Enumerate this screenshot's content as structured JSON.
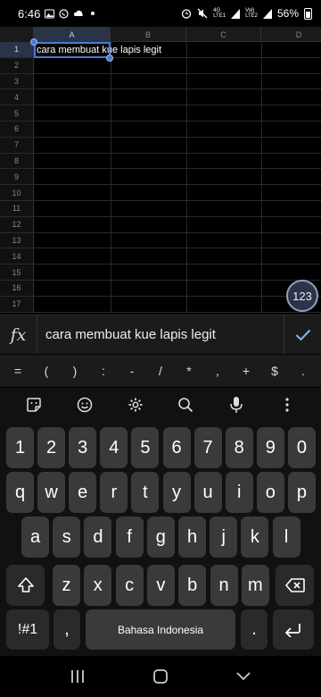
{
  "status_bar": {
    "time": "6:46",
    "battery": "56%",
    "net_top": "4G",
    "net_bottom": "LTE1",
    "volte_top": "Vol)",
    "volte_bottom": "LTE2"
  },
  "sheet": {
    "columns": [
      "A",
      "B",
      "C",
      "D"
    ],
    "rows": [
      "1",
      "2",
      "3",
      "4",
      "5",
      "6",
      "7",
      "8",
      "9",
      "10",
      "11",
      "12",
      "13",
      "14",
      "15",
      "16",
      "17"
    ],
    "selected_cell_text": "cara membuat kue lapis legit",
    "numeric_keyboard_badge": "123"
  },
  "formula_bar": {
    "fx_label": "fx",
    "value": "cara membuat kue lapis legit"
  },
  "symbols": [
    "=",
    "(",
    ")",
    ":",
    "-",
    "/",
    "*",
    ",",
    "+",
    "$",
    "."
  ],
  "keyboard": {
    "number_row": [
      "1",
      "2",
      "3",
      "4",
      "5",
      "6",
      "7",
      "8",
      "9",
      "0"
    ],
    "row1": [
      "q",
      "w",
      "e",
      "r",
      "t",
      "y",
      "u",
      "i",
      "o",
      "p"
    ],
    "row2": [
      "a",
      "s",
      "d",
      "f",
      "g",
      "h",
      "j",
      "k",
      "l"
    ],
    "row3": [
      "z",
      "x",
      "c",
      "v",
      "b",
      "n",
      "m"
    ],
    "symbols_key": "!#1",
    "comma_key": ",",
    "space_label": "Bahasa Indonesia",
    "period_key": "."
  },
  "colors": {
    "selection": "#4a7bd1",
    "background": "#000000",
    "key": "#3a3a3a"
  }
}
